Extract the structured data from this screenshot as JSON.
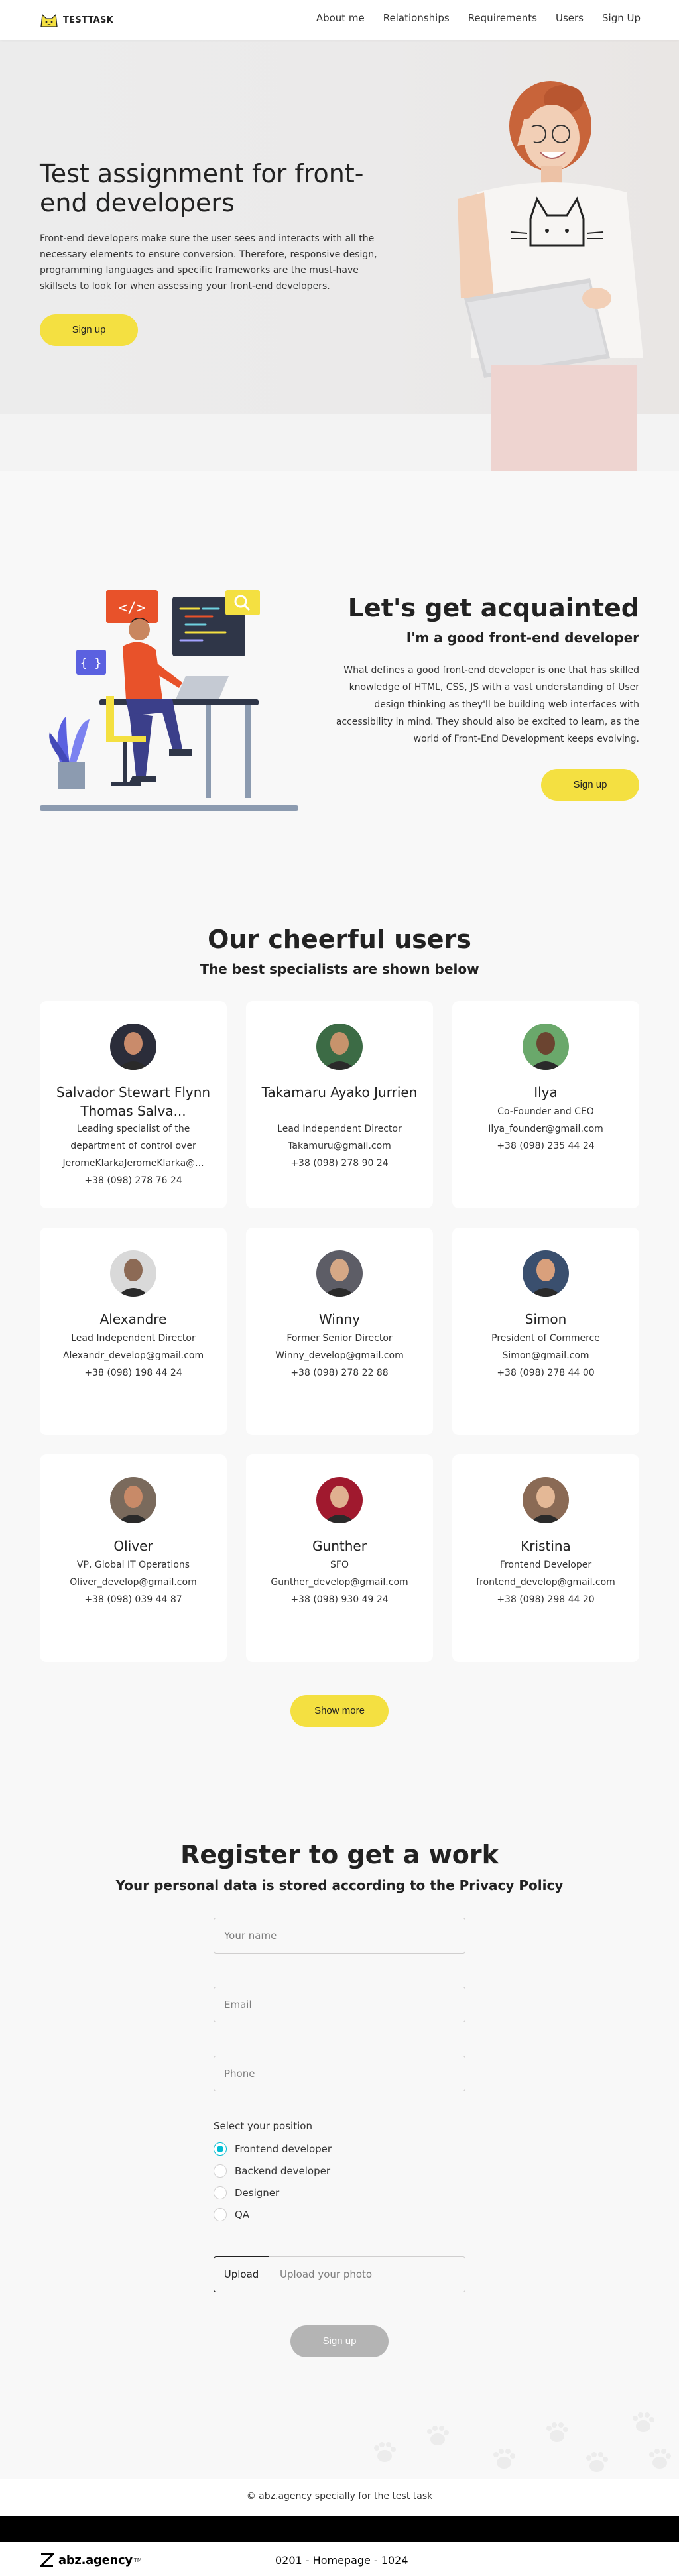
{
  "header": {
    "logo_text": "TESTTASK",
    "nav": [
      "About me",
      "Relationships",
      "Requirements",
      "Users",
      "Sign Up"
    ]
  },
  "hero": {
    "title": "Test assignment for front-end developers",
    "text": "Front-end developers make sure the user sees and interacts with all the necessary elements to ensure conversion. Therefore, responsive design, programming languages and specific frameworks are the must-have skillsets to look for when assessing your front-end developers.",
    "button": "Sign up"
  },
  "about": {
    "title": "Let's get acquainted",
    "subtitle": "I'm a good front-end developer",
    "text": "What defines a good front-end developer is one that has skilled knowledge of HTML, CSS, JS with a vast understanding of User design thinking as they'll be building web interfaces with accessibility in mind. They should also be excited to learn, as the world of Front-End Development keeps evolving.",
    "button": "Sign up",
    "illus_code_tag": "</>",
    "illus_brace_tag": "{ }"
  },
  "users": {
    "title": "Our cheerful users",
    "subtitle": "The best specialists are shown below",
    "cards": [
      {
        "name": "Salvador Stewart Flynn Thomas Salva...",
        "position": "Leading specialist of the department of control over",
        "email": "JeromeKlarkaJeromeKlarka@...",
        "phone": "+38 (098) 278 76 24",
        "avatar_color": "#2b2d3a",
        "skin": "#c98b6b"
      },
      {
        "name": "Takamaru Ayako Jurrien",
        "position": "Lead Independent Director",
        "email": "Takamuru@gmail.com",
        "phone": "+38 (098) 278 90 24",
        "avatar_color": "#3c6b45",
        "skin": "#c7936c"
      },
      {
        "name": "Ilya",
        "position": "Co-Founder and CEO",
        "email": "Ilya_founder@gmail.com",
        "phone": "+38 (098) 235 44 24",
        "avatar_color": "#6aa86b",
        "skin": "#6b4430"
      },
      {
        "name": "Alexandre",
        "position": "Lead Independent Director",
        "email": "Alexandr_develop@gmail.com",
        "phone": "+38 (098) 198 44 24",
        "avatar_color": "#d9d9d9",
        "skin": "#8c6a55"
      },
      {
        "name": "Winny",
        "position": "Former Senior Director",
        "email": "Winny_develop@gmail.com",
        "phone": "+38 (098) 278 22 88",
        "avatar_color": "#5d5d66",
        "skin": "#d5a886"
      },
      {
        "name": "Simon",
        "position": "President of Commerce",
        "email": "Simon@gmail.com",
        "phone": "+38 (098) 278 44 00",
        "avatar_color": "#3a4f6e",
        "skin": "#d9a07c"
      },
      {
        "name": "Oliver",
        "position": "VP, Global IT Operations",
        "email": "Oliver_develop@gmail.com",
        "phone": "+38 (098) 039 44 87",
        "avatar_color": "#7a6a5c",
        "skin": "#c88a68"
      },
      {
        "name": "Gunther",
        "position": "SFO",
        "email": "Gunther_develop@gmail.com",
        "phone": "+38 (098) 930 49 24",
        "avatar_color": "#a0192e",
        "skin": "#e0b090"
      },
      {
        "name": "Kristina",
        "position": "Frontend Developer",
        "email": "frontend_develop@gmail.com",
        "phone": "+38 (098) 298 44 20",
        "avatar_color": "#8a6a55",
        "skin": "#e4b896"
      }
    ],
    "show_more": "Show more"
  },
  "register": {
    "title": "Register to get a work",
    "subtitle": "Your personal data is stored according to the Privacy Policy",
    "name_placeholder": "Your name",
    "email_placeholder": "Email",
    "phone_placeholder": "Phone",
    "position_label": "Select your position",
    "positions": [
      {
        "label": "Frontend developer",
        "checked": true
      },
      {
        "label": "Backend developer",
        "checked": false
      },
      {
        "label": "Designer",
        "checked": false
      },
      {
        "label": "QA",
        "checked": false
      }
    ],
    "upload_button": "Upload",
    "upload_placeholder": "Upload your photo",
    "submit": "Sign up"
  },
  "footer": {
    "copyright": "© abz.agency specially for the test task",
    "agency_logo": "abz.agency",
    "agency_mark": "TM",
    "page_meta": "0201 - Homepage - 1024"
  },
  "colors": {
    "accent_yellow": "#f4e041",
    "radio_cyan": "#00bdd3",
    "disabled_gray": "#b4b4b4",
    "background": "#f8f8f8"
  }
}
